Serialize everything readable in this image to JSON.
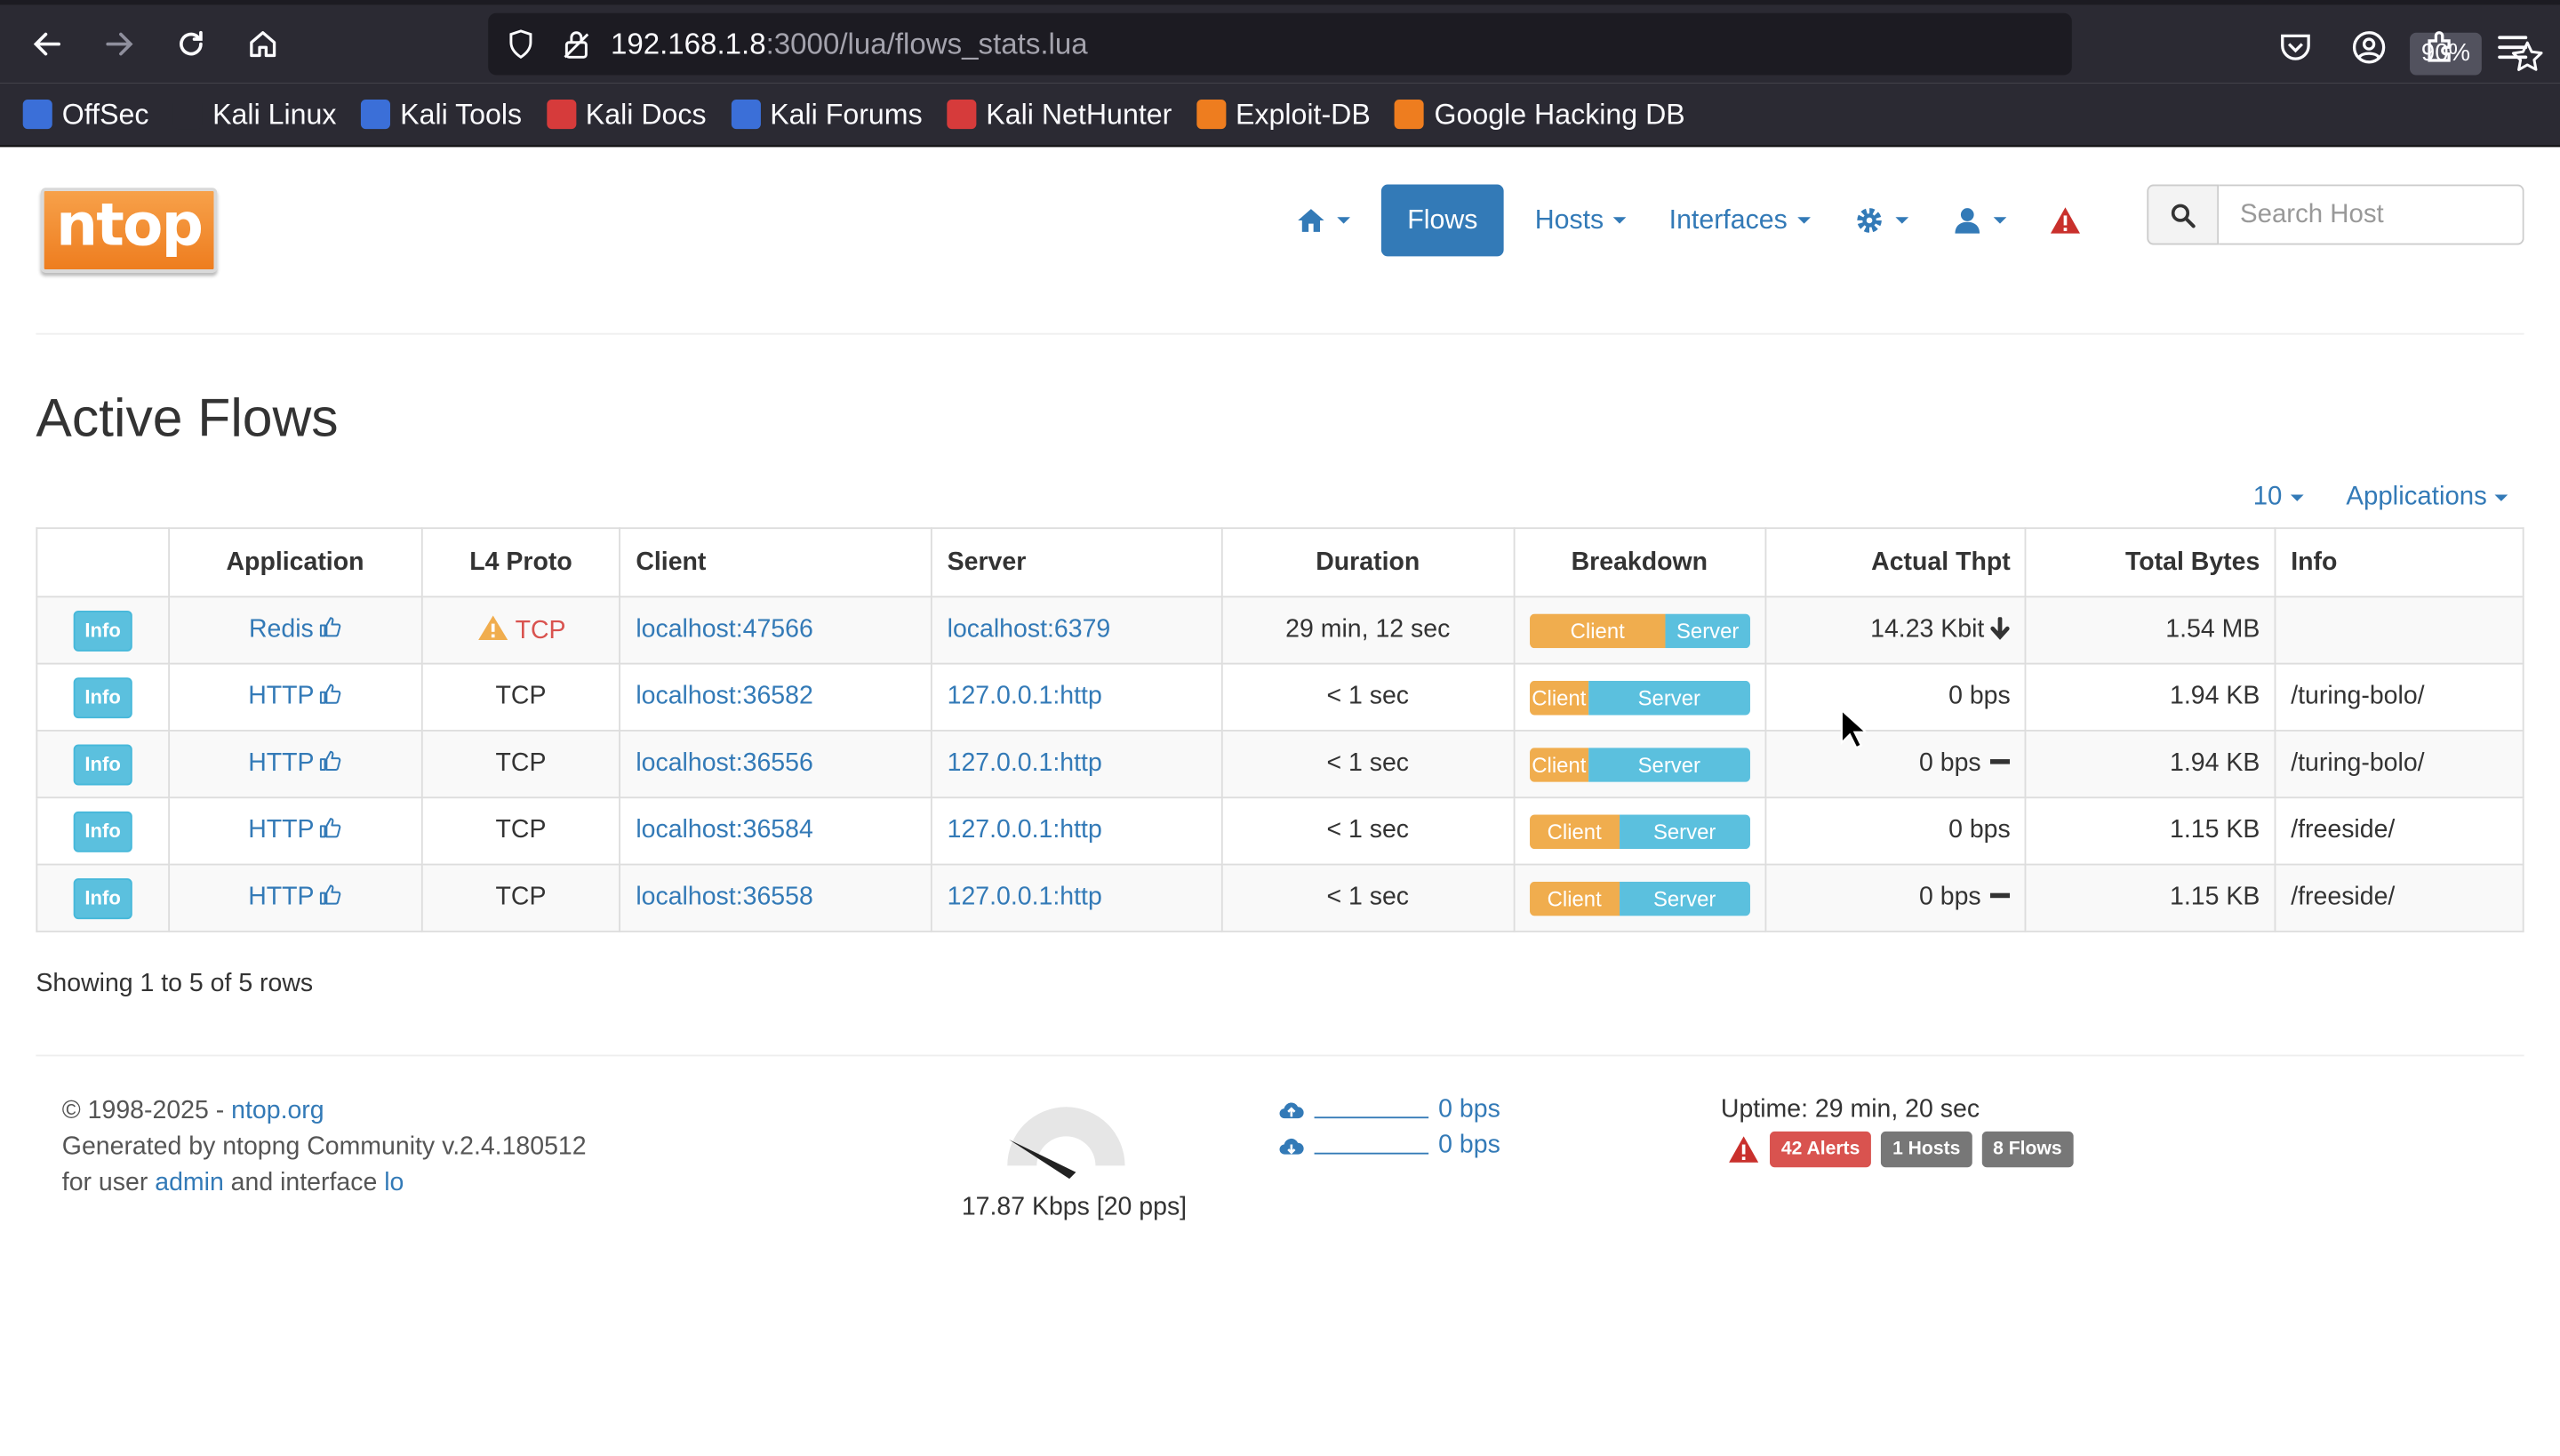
{
  "browser": {
    "url_host": "192.168.1.8",
    "url_path": ":3000/lua/flows_stats.lua",
    "zoom": "90%",
    "bookmarks": [
      {
        "label": "OffSec",
        "color": "#3b6fd8"
      },
      {
        "label": "Kali Linux",
        "color": "#2b2a33"
      },
      {
        "label": "Kali Tools",
        "color": "#3b6fd8"
      },
      {
        "label": "Kali Docs",
        "color": "#d63b3b"
      },
      {
        "label": "Kali Forums",
        "color": "#3b6fd8"
      },
      {
        "label": "Kali NetHunter",
        "color": "#d63b3b"
      },
      {
        "label": "Exploit-DB",
        "color": "#ee7d1f"
      },
      {
        "label": "Google Hacking DB",
        "color": "#ee7d1f"
      }
    ]
  },
  "header": {
    "logo": "ntop",
    "nav": {
      "flows": "Flows",
      "hosts": "Hosts",
      "interfaces": "Interfaces"
    },
    "search_placeholder": "Search Host"
  },
  "main": {
    "title": "Active Flows",
    "rows_per_page": "10",
    "applications_filter": "Applications",
    "columns": [
      "",
      "Application",
      "L4 Proto",
      "Client",
      "Server",
      "Duration",
      "Breakdown",
      "Actual Thpt",
      "Total Bytes",
      "Info"
    ],
    "info_button": "Info",
    "breakdown_labels": {
      "client": "Client",
      "server": "Server"
    },
    "rows": [
      {
        "app": "Redis",
        "proto": "TCP",
        "proto_warning": true,
        "client_host": "localhost",
        "client_port": ":47566",
        "server_host": "localhost",
        "server_port": ":6379",
        "duration": "29 min, 12 sec",
        "client_pct": 62,
        "thpt": "14.23 Kbit",
        "trend": "down",
        "bytes": "1.54 MB",
        "info": ""
      },
      {
        "app": "HTTP",
        "proto": "TCP",
        "proto_warning": false,
        "client_host": "localhost",
        "client_port": ":36582",
        "server_host": "127.0.0.1",
        "server_port": ":http",
        "duration": "< 1 sec",
        "client_pct": 27,
        "thpt": "0 bps",
        "trend": "none",
        "bytes": "1.94 KB",
        "info": "/turing-bolo/"
      },
      {
        "app": "HTTP",
        "proto": "TCP",
        "proto_warning": false,
        "client_host": "localhost",
        "client_port": ":36556",
        "server_host": "127.0.0.1",
        "server_port": ":http",
        "duration": "< 1 sec",
        "client_pct": 27,
        "thpt": "0 bps",
        "trend": "flat",
        "bytes": "1.94 KB",
        "info": "/turing-bolo/"
      },
      {
        "app": "HTTP",
        "proto": "TCP",
        "proto_warning": false,
        "client_host": "localhost",
        "client_port": ":36584",
        "server_host": "127.0.0.1",
        "server_port": ":http",
        "duration": "< 1 sec",
        "client_pct": 41,
        "thpt": "0 bps",
        "trend": "none",
        "bytes": "1.15 KB",
        "info": "/freeside/"
      },
      {
        "app": "HTTP",
        "proto": "TCP",
        "proto_warning": false,
        "client_host": "localhost",
        "client_port": ":36558",
        "server_host": "127.0.0.1",
        "server_port": ":http",
        "duration": "< 1 sec",
        "client_pct": 41,
        "thpt": "0 bps",
        "trend": "flat",
        "bytes": "1.15 KB",
        "info": "/freeside/"
      }
    ],
    "showing": "Showing 1 to 5 of 5 rows"
  },
  "footer": {
    "copyright": "© 1998-2025 - ",
    "site_link": "ntop.org",
    "generated": "Generated by ntopng Community v.2.4.180512",
    "for_user_prefix": "for user ",
    "user": "admin",
    "interface_prefix": " and interface ",
    "interface": "lo",
    "gauge_label": "17.87 Kbps [20 pps]",
    "upload": "0 bps",
    "download": "0 bps",
    "uptime": "Uptime: 29 min, 20 sec",
    "alerts_badge": "42 Alerts",
    "hosts_badge": "1 Hosts",
    "flows_badge": "8 Flows"
  }
}
